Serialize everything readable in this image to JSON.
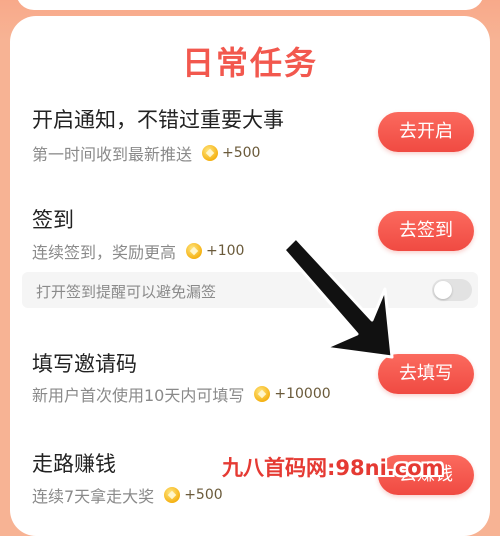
{
  "page": {
    "title": "日常任务"
  },
  "tasks": [
    {
      "title": "开启通知，不错过重要大事",
      "subtitle": "第一时间收到最新推送",
      "reward": "+500",
      "button": "去开启"
    },
    {
      "title": "签到",
      "subtitle": "连续签到，奖励更高",
      "reward": "+100",
      "button": "去签到",
      "reminder": {
        "label": "打开签到提醒可以避免漏签",
        "enabled": false
      }
    },
    {
      "title": "填写邀请码",
      "subtitle": "新用户首次使用10天内可填写",
      "reward": "+10000",
      "button": "去填写"
    },
    {
      "title": "走路赚钱",
      "subtitle": "连续7天拿走大奖",
      "reward": "+500",
      "button": "去赚钱"
    }
  ],
  "watermark": "九八首码网:98ni.com",
  "colors": {
    "accent": "#f2584e",
    "button": "#f04a42",
    "background": "#f7b394",
    "coin": "#f5b214"
  },
  "icons": {
    "reward": "coin-icon",
    "annotation": "arrow-icon"
  }
}
